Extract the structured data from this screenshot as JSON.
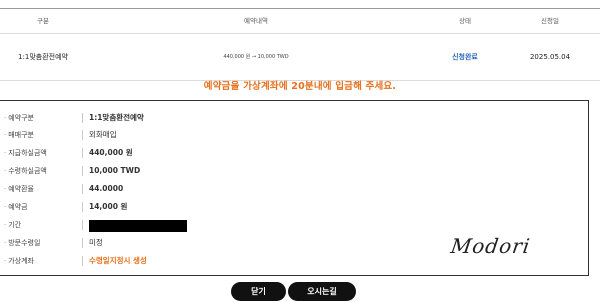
{
  "table": {
    "headers": [
      "구분",
      "예약내역",
      "상태",
      "신청일"
    ],
    "row": {
      "type": "1:1맞춤환전예약",
      "detail": "440,000 원  → 10,000 TWD",
      "status": "신청완료",
      "date": "2025.05.04"
    }
  },
  "notice": "예약금을 가상계좌에 20분내에 입금해 주세요.",
  "details": [
    {
      "label": "예약구분",
      "value": "1:1맞춤환전예약"
    },
    {
      "label": "매매구분",
      "value": "외화매입"
    },
    {
      "label": "지급하실금액",
      "value": "440,000 원"
    },
    {
      "label": "수령하실금액",
      "value": "10,000 TWD"
    },
    {
      "label": "예약환율",
      "value": "44.0000"
    },
    {
      "label": "예약금",
      "value": "14,000 원"
    },
    {
      "label": "기간",
      "value": ""
    },
    {
      "label": "방문수령일",
      "value": "미정"
    },
    {
      "label": "가상계좌",
      "value": "수령일지정시 생성"
    }
  ],
  "signature": "Modori",
  "buttons": {
    "close": "닫기",
    "map": "오시는길"
  },
  "colors": {
    "accent": "#e8711c",
    "status": "#2a67b8",
    "button": "#111111"
  }
}
